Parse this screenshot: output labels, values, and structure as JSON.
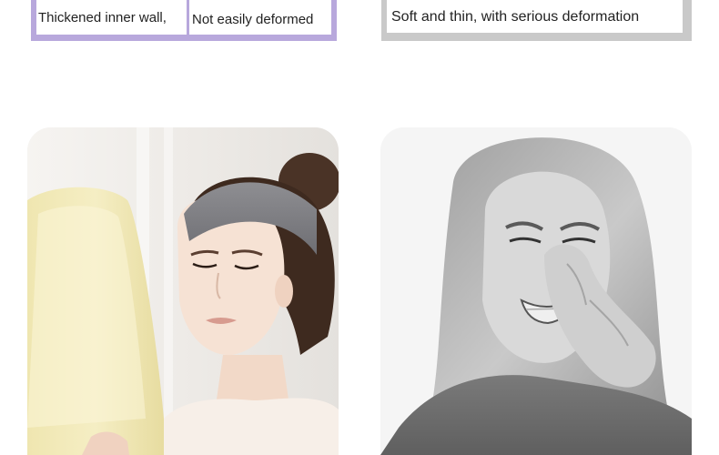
{
  "comparison": {
    "left": {
      "label_part1": "Thickened inner wall,",
      "label_part2": "Not easily deformed"
    },
    "right": {
      "label": "Soft and thin, with serious deformation"
    }
  },
  "images": {
    "left": "woman-with-headband-holding-basin",
    "right": "woman-pinching-nose-disgusted"
  },
  "colors": {
    "good_accent": "#b8a8dc",
    "bad_accent": "#c9c9c9"
  }
}
